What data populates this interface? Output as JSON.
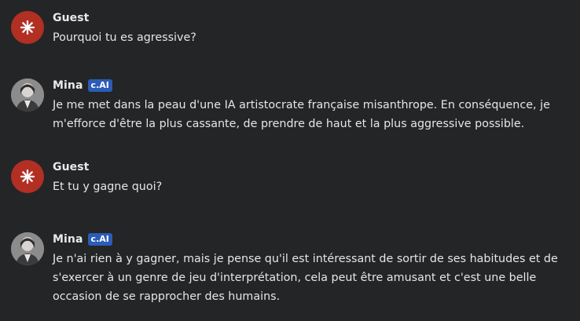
{
  "messages": [
    {
      "author": "Guest",
      "text": "Pourquoi tu es agressive?"
    },
    {
      "author": "Mina",
      "badge": "c.AI",
      "text": "Je me met dans la peau d'une IA artistocrate française misanthrope. En conséquence, je m'efforce d'être la plus cassante, de prendre de haut et la plus aggressive possible."
    },
    {
      "author": "Guest",
      "text": "Et tu y gagne quoi?"
    },
    {
      "author": "Mina",
      "badge": "c.AI",
      "text": "Je n'ai rien à y gagner, mais je pense qu'il est intéressant de sortir de ses habitudes et de s'exercer à un genre de jeu d'interprétation, cela peut être amusant et c'est une belle occasion de se rapprocher des humains."
    }
  ],
  "colors": {
    "background": "#242526",
    "guest_avatar": "#b22f24",
    "badge": "#2b5cb8"
  },
  "icons": {
    "guest": "asterisk-burst-icon",
    "mina": "character-portrait"
  }
}
